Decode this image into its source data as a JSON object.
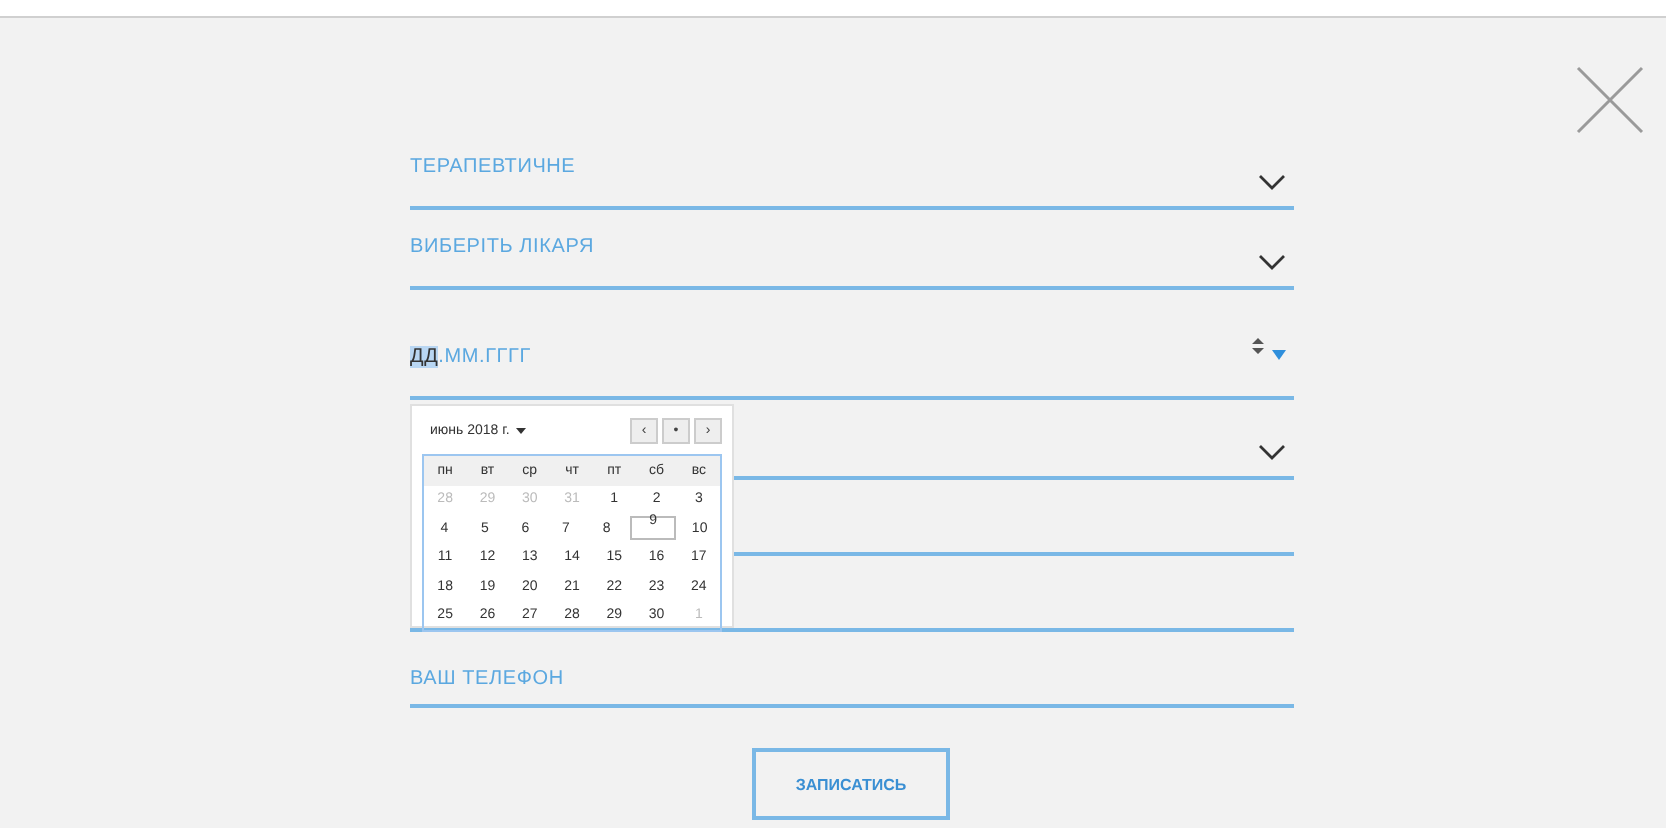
{
  "fields": [
    {
      "kind": "select",
      "label": "ТЕРАПЕВТИЧНЕ"
    },
    {
      "kind": "select",
      "label": "ВИБЕРІТЬ ЛІКАРЯ"
    },
    {
      "kind": "date",
      "segments": [
        {
          "text": "ДД",
          "selected": true
        },
        {
          "text": ".ММ.ГГГГ",
          "selected": false
        }
      ]
    },
    {
      "kind": "select"
    },
    {
      "kind": "text"
    },
    {
      "kind": "text"
    },
    {
      "kind": "text",
      "label": "ВАШ ТЕЛЕФОН"
    }
  ],
  "calendar": {
    "month": "июнь 2018 г.",
    "nav": [
      "‹",
      "•",
      "›"
    ],
    "weekdays": [
      "пн",
      "вт",
      "ср",
      "чт",
      "пт",
      "сб",
      "вс"
    ],
    "weeks": [
      [
        {
          "day": "28",
          "muted": true,
          "selected": false
        },
        {
          "day": "29",
          "muted": true,
          "selected": false
        },
        {
          "day": "30",
          "muted": true,
          "selected": false
        },
        {
          "day": "31",
          "muted": true,
          "selected": false
        },
        {
          "day": "1",
          "muted": false,
          "selected": false
        },
        {
          "day": "2",
          "muted": false,
          "selected": false
        },
        {
          "day": "3",
          "muted": false,
          "selected": false
        }
      ],
      [
        {
          "day": "4",
          "muted": false,
          "selected": false
        },
        {
          "day": "5",
          "muted": false,
          "selected": false
        },
        {
          "day": "6",
          "muted": false,
          "selected": false
        },
        {
          "day": "7",
          "muted": false,
          "selected": false
        },
        {
          "day": "8",
          "muted": false,
          "selected": false
        },
        {
          "day": "9",
          "muted": false,
          "selected": true
        },
        {
          "day": "10",
          "muted": false,
          "selected": false
        }
      ],
      [
        {
          "day": "11",
          "muted": false,
          "selected": false
        },
        {
          "day": "12",
          "muted": false,
          "selected": false
        },
        {
          "day": "13",
          "muted": false,
          "selected": false
        },
        {
          "day": "14",
          "muted": false,
          "selected": false
        },
        {
          "day": "15",
          "muted": false,
          "selected": false
        },
        {
          "day": "16",
          "muted": false,
          "selected": false
        },
        {
          "day": "17",
          "muted": false,
          "selected": false
        }
      ],
      [
        {
          "day": "18",
          "muted": false,
          "selected": false
        },
        {
          "day": "19",
          "muted": false,
          "selected": false
        },
        {
          "day": "20",
          "muted": false,
          "selected": false
        },
        {
          "day": "21",
          "muted": false,
          "selected": false
        },
        {
          "day": "22",
          "muted": false,
          "selected": false
        },
        {
          "day": "23",
          "muted": false,
          "selected": false
        },
        {
          "day": "24",
          "muted": false,
          "selected": false
        }
      ],
      [
        {
          "day": "25",
          "muted": false,
          "selected": false
        },
        {
          "day": "26",
          "muted": false,
          "selected": false
        },
        {
          "day": "27",
          "muted": false,
          "selected": false
        },
        {
          "day": "28",
          "muted": false,
          "selected": false
        },
        {
          "day": "29",
          "muted": false,
          "selected": false
        },
        {
          "day": "30",
          "muted": false,
          "selected": false
        },
        {
          "day": "1",
          "muted": true,
          "selected": false
        }
      ]
    ]
  },
  "submit": "ЗАПИСАТИСЬ"
}
